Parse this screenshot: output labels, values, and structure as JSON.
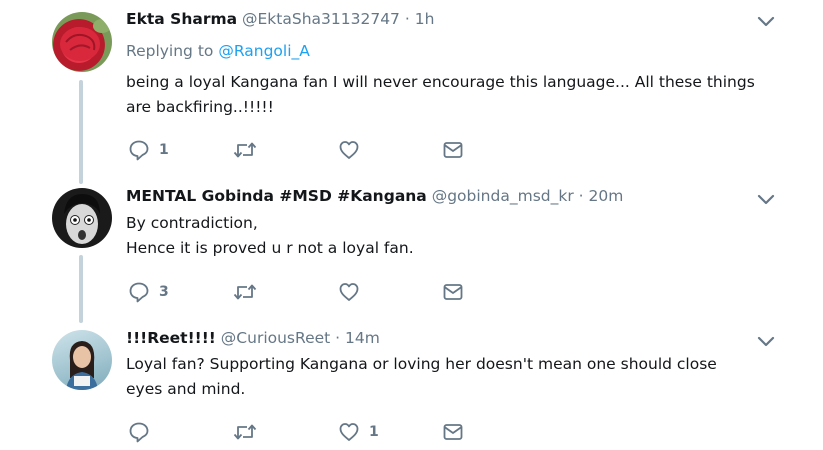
{
  "tweets": [
    {
      "name": "Ekta Sharma",
      "handle": "@EktaSha31132747",
      "time": "1h",
      "replying_label": "Replying to",
      "replying_to": "@Rangoli_A",
      "text_line1": "being a loyal Kangana fan I will never encourage this language... All these things",
      "text_line2": "are backfiring..!!!!!",
      "reply_count": "1",
      "retweet_count": "",
      "like_count": ""
    },
    {
      "name": "MENTAL Gobinda #MSD #Kangana",
      "handle": "@gobinda_msd_kr",
      "time": "20m",
      "text_line1": "By contradiction,",
      "text_line2": "Hence it is proved u r not a loyal fan.",
      "reply_count": "3",
      "retweet_count": "",
      "like_count": ""
    },
    {
      "name": "!!!Reet!!!!",
      "handle": "@CuriousReet",
      "time": "14m",
      "text_line1": "Loyal fan?  Supporting Kangana or loving her doesn't mean one should close",
      "text_line2": "eyes and mind.",
      "reply_count": "",
      "retweet_count": "",
      "like_count": "1"
    }
  ],
  "separator": "·",
  "colors": {
    "link": "#1da1f2",
    "secondary": "#657786",
    "thread_line": "#c4d2dc"
  },
  "icons": [
    "reply-icon",
    "retweet-icon",
    "like-icon",
    "message-icon",
    "chevron-down-icon"
  ]
}
